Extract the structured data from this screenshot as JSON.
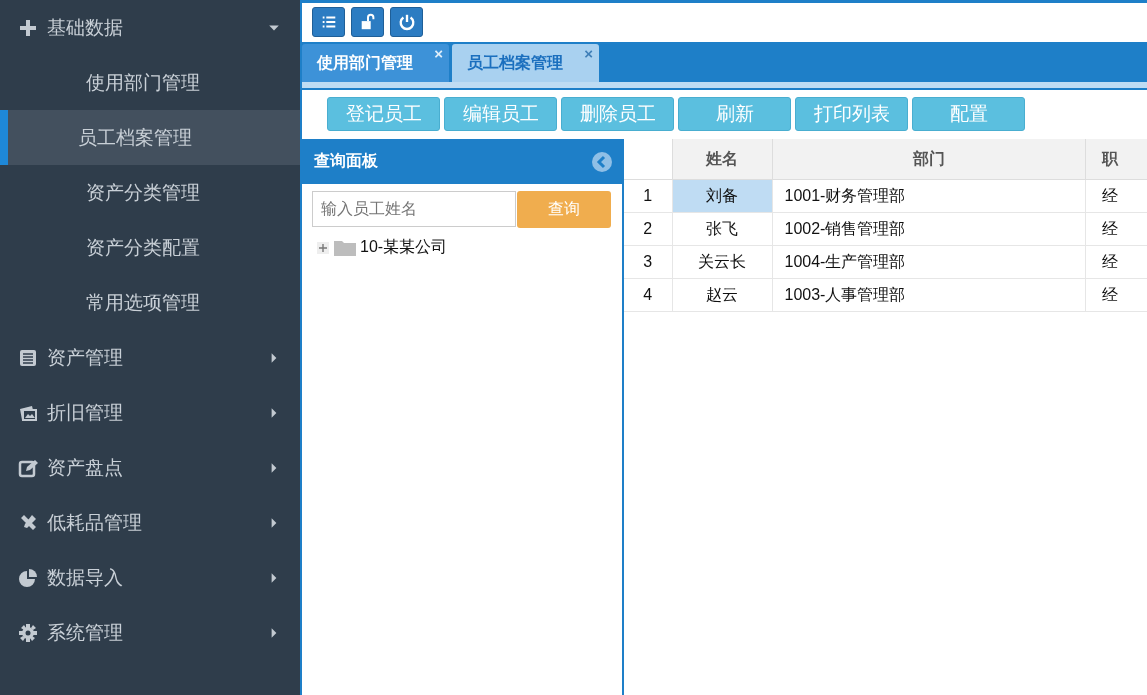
{
  "sidebar": {
    "items": [
      {
        "label": "基础数据",
        "expanded": true,
        "children": [
          {
            "label": "使用部门管理",
            "selected": false
          },
          {
            "label": "员工档案管理",
            "selected": true
          },
          {
            "label": "资产分类管理",
            "selected": false
          },
          {
            "label": "资产分类配置",
            "selected": false
          },
          {
            "label": "常用选项管理",
            "selected": false
          }
        ]
      },
      {
        "label": "资产管理",
        "expanded": false
      },
      {
        "label": "折旧管理",
        "expanded": false
      },
      {
        "label": "资产盘点",
        "expanded": false
      },
      {
        "label": "低耗品管理",
        "expanded": false
      },
      {
        "label": "数据导入",
        "expanded": false
      },
      {
        "label": "系统管理",
        "expanded": false
      }
    ]
  },
  "tabs": [
    {
      "label": "使用部门管理",
      "close": "×",
      "selected": false
    },
    {
      "label": "员工档案管理",
      "close": "×",
      "selected": true
    }
  ],
  "actions": [
    "登记员工",
    "编辑员工",
    "删除员工",
    "刷新",
    "打印列表",
    "配置"
  ],
  "query_panel": {
    "title": "查询面板",
    "placeholder": "输入员工姓名",
    "button": "查询",
    "tree": [
      {
        "label": "10-某某公司",
        "expanded": false
      }
    ]
  },
  "grid": {
    "columns": [
      "姓名",
      "部门",
      "职"
    ],
    "rows": [
      {
        "number": "1",
        "name": "刘备",
        "department": "1001-财务管理部",
        "column_3": "经",
        "selected": true
      },
      {
        "number": "2",
        "name": "张飞",
        "department": "1002-销售管理部",
        "column_3": "经",
        "selected": false
      },
      {
        "number": "3",
        "name": "关云长",
        "department": "1004-生产管理部",
        "column_3": "经",
        "selected": false
      },
      {
        "number": "4",
        "name": "赵云",
        "department": "1003-人事管理部",
        "column_3": "经",
        "selected": false
      }
    ]
  }
}
